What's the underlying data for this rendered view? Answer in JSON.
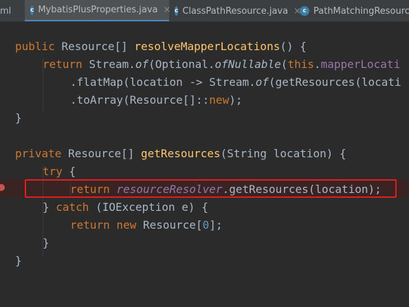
{
  "tabs": [
    {
      "label": "ml",
      "close": ""
    },
    {
      "icon": "c",
      "label": "MybatisPlusProperties.java",
      "close": "×"
    },
    {
      "icon": "c",
      "label": "ClassPathResource.java",
      "close": "×"
    },
    {
      "icon": "c",
      "label": "PathMatchingResourceP",
      "close": ""
    }
  ],
  "code": {
    "l1": {
      "kw": "public ",
      "type": "Resource[] ",
      "fn": "resolveMapperLocations",
      "rest": "() {"
    },
    "l2": {
      "kw": "return ",
      "a": "Stream.",
      "of": "of",
      "b": "(Optional.",
      "ofn": "ofNullable",
      "c": "(",
      "this": "this",
      "d": ".",
      "field": "mapperLocati"
    },
    "l3": {
      "a": ".flatMap(location -> Stream.",
      "of": "of",
      "b": "(getResources(locati"
    },
    "l4": {
      "a": ".toArray(Resource[]::",
      "kw": "new",
      "b": ");"
    },
    "l5": {
      "a": "}"
    },
    "l7": {
      "kw": "private ",
      "type": "Resource[] ",
      "fn": "getResources",
      "rest": "(String location) {"
    },
    "l8": {
      "kw": "try",
      "rest": " {"
    },
    "l9": {
      "kw": "return ",
      "field": "resourceResolver",
      "rest": ".getResources(location);"
    },
    "l10": {
      "a": "} ",
      "kw": "catch",
      "rest": " (IOException e) {"
    },
    "l11": {
      "kw": "return new ",
      "a": "Resource[",
      "num": "0",
      "b": "];"
    },
    "l12": {
      "a": "}"
    },
    "l13": {
      "a": "}"
    }
  },
  "colors": {
    "keyword": "#cc7832",
    "method": "#ffc66d",
    "field": "#9876aa",
    "number": "#6897bb",
    "text": "#a9b7c6",
    "highlight_box": "#e31e1e"
  }
}
